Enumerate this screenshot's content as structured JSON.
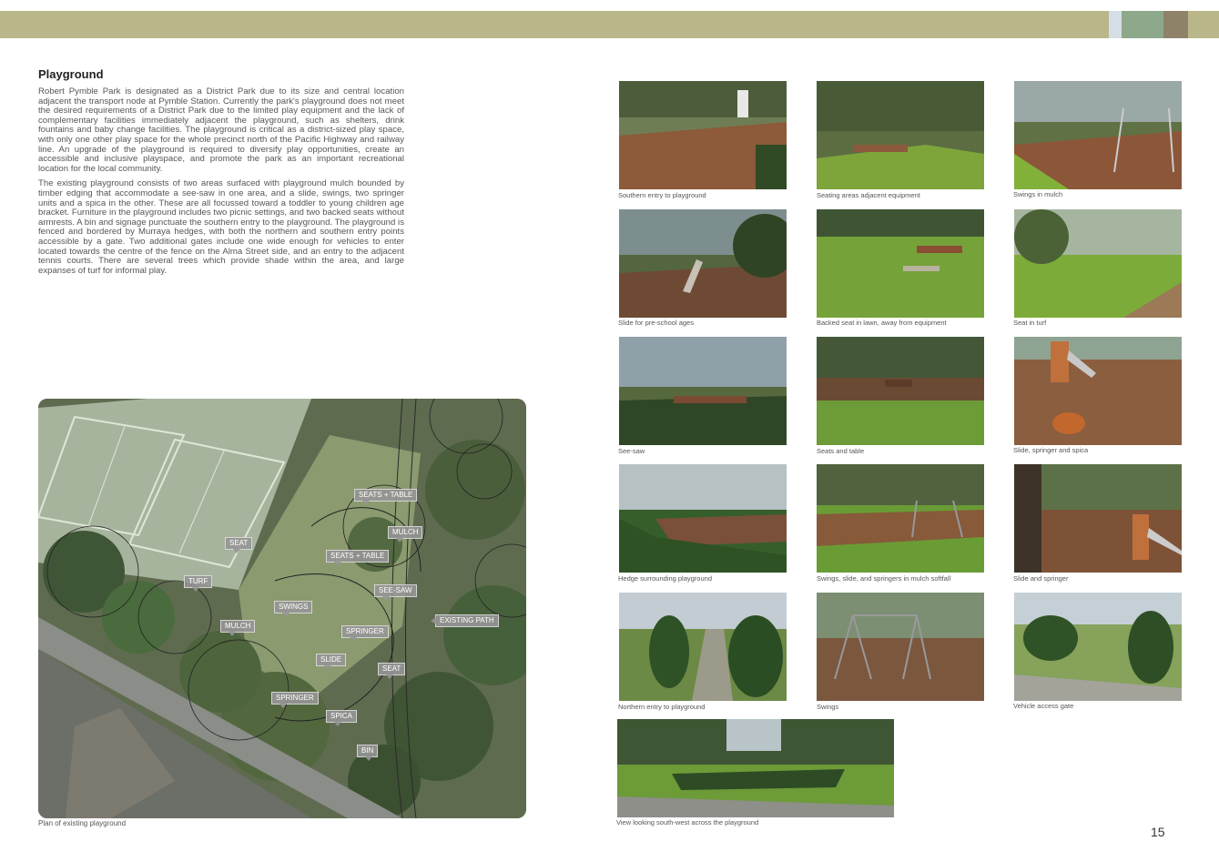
{
  "header": {
    "bar_color": "#b9b78a",
    "swatches": [
      "#d5dde6",
      "#8ea88b",
      "#8e8269"
    ]
  },
  "section": {
    "title": "Playground",
    "paragraphs": [
      "Robert Pymble Park is designated as a District Park due to its size and central location adjacent the transport node at Pymble Station. Currently the park's playground does not meet the desired requirements of a District Park due to the limited play equipment and the lack of complementary facilities immediately adjacent the playground, such as shelters, drink fountains and baby change facilities. The playground is critical as a district-sized play space, with only one other play space for the whole precinct north of the Pacific Highway and railway line. An upgrade of the playground is required to diversify play opportunities, create an accessible and inclusive playspace, and promote the park as an important recreational location for the local community.",
      "The existing playground consists of two areas surfaced with playground mulch bounded by timber edging that accommodate a see-saw in one area, and a slide, swings, two springer units and a spica in the other. These are all focussed toward a toddler to young children age bracket. Furniture in the playground includes two picnic settings, and two backed seats without armrests. A bin and signage punctuate the southern entry to the playground. The playground is fenced and bordered by Murraya hedges, with both the northern and southern entry points accessible by a gate. Two additional gates include one wide enough for vehicles to enter located towards the centre of the fence on the Alma Street side, and an entry to the adjacent tennis courts. There are several trees which provide shade within the area, and large expanses of turf for informal play."
    ]
  },
  "map": {
    "caption": "Plan of existing playground",
    "labels": [
      "SEATS + TABLE",
      "MULCH",
      "SEAT",
      "SEATS + TABLE",
      "TURF",
      "SEE-SAW",
      "SWINGS",
      "EXISTING PATH",
      "MULCH",
      "SPRINGER",
      "SLIDE",
      "SEAT",
      "SPRINGER",
      "SPICA",
      "BIN"
    ]
  },
  "photos": {
    "captions": [
      "Southern entry to playground",
      "Seating areas adjacent equipment",
      "Swings in mulch",
      "Slide for pre-school ages",
      "Backed seat in lawn, away from equipment",
      "Seat in turf",
      "See-saw",
      "Seats and table",
      "Slide, springer and spica",
      "Hedge surrounding playground",
      "Swings, slide, and springers in mulch softfall",
      "Slide and springer",
      "Northern entry to playground",
      "Swings",
      "Vehicle access gate",
      "View looking south-west across the playground"
    ]
  },
  "page_number": "15"
}
